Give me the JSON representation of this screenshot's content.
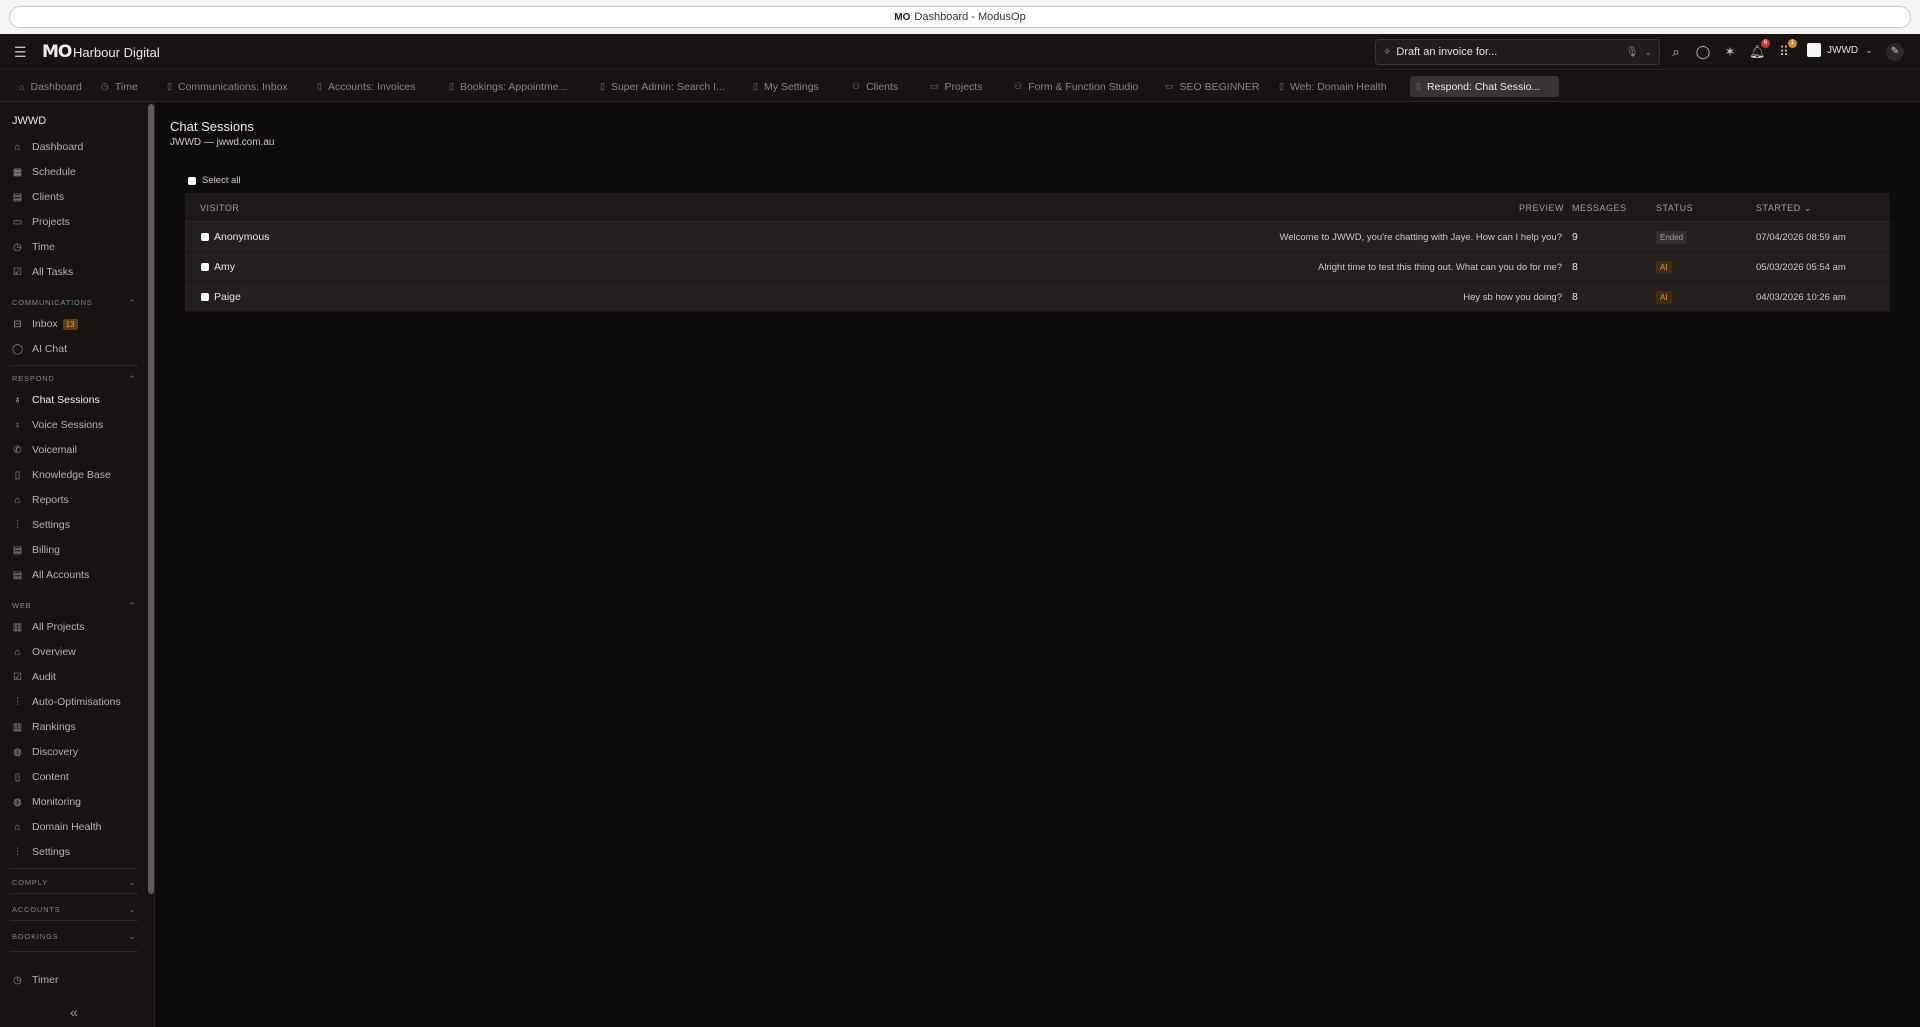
{
  "browser": {
    "title": "Dashboard - ModusOp",
    "favicon": "MO"
  },
  "header": {
    "logo": "MO",
    "org_name": "Harbour Digital",
    "ai_prompt_placeholder": "Draft an invoice for...",
    "notifications_badge": "6",
    "apps_badge": "1",
    "account_label": "JWWD"
  },
  "tabs": [
    {
      "label": "Dashboard",
      "icon": "home-icon"
    },
    {
      "label": "Time",
      "icon": "clock-icon"
    },
    {
      "label": "Communications: Inbox",
      "icon": "file-icon"
    },
    {
      "label": "Accounts: Invoices",
      "icon": "file-icon"
    },
    {
      "label": "Bookings: Appointme...",
      "icon": "file-icon"
    },
    {
      "label": "Super Admin: Search I...",
      "icon": "file-icon"
    },
    {
      "label": "My Settings",
      "icon": "file-icon"
    },
    {
      "label": "Clients",
      "icon": "users-icon"
    },
    {
      "label": "Projects",
      "icon": "folder-icon"
    },
    {
      "label": "Form & Function Studio",
      "icon": "users-icon"
    },
    {
      "label": "SEO BEGINNER",
      "icon": "folder-icon"
    },
    {
      "label": "Web: Domain Health",
      "icon": "file-icon"
    },
    {
      "label": "Respond: Chat Sessio...",
      "icon": "file-icon",
      "active": true
    }
  ],
  "sidebar": {
    "org": "JWWD",
    "main_items": [
      "Dashboard",
      "Schedule",
      "Clients",
      "Projects",
      "Time",
      "All Tasks"
    ],
    "communications": {
      "title": "COMMUNICATIONS",
      "items": [
        "Inbox",
        "AI Chat"
      ],
      "inbox_count": "13"
    },
    "respond": {
      "title": "RESPOND",
      "items": [
        "Chat Sessions",
        "Voice Sessions",
        "Voicemail",
        "Knowledge Base",
        "Reports",
        "Settings",
        "Billing",
        "All Accounts"
      ]
    },
    "web": {
      "title": "WEB",
      "items": [
        "All Projects",
        "Overview",
        "Audit",
        "Auto-Optimisations",
        "Rankings",
        "Discovery",
        "Content",
        "Monitoring",
        "Domain Health",
        "Settings"
      ]
    },
    "collapsed_sections": [
      "COMPLY",
      "ACCOUNTS",
      "BOOKINGS"
    ],
    "timer": "Timer"
  },
  "page": {
    "title": "Chat Sessions",
    "subtitle": "JWWD — jwwd.com.au",
    "select_all": "Select all",
    "columns": {
      "visitor": "VISITOR",
      "preview": "PREVIEW",
      "messages": "MESSAGES",
      "status": "STATUS",
      "started": "STARTED"
    },
    "rows": [
      {
        "visitor": "Anonymous",
        "preview": "Welcome to JWWD, you're chatting with Jaye. How can I help you?",
        "messages": "9",
        "status": "Ended",
        "started": "07/04/2026 08:59 am"
      },
      {
        "visitor": "Amy",
        "preview": "Alright time to test this thing out. What can you do for me?",
        "messages": "8",
        "status": "AI",
        "started": "05/03/2026 05:54 am"
      },
      {
        "visitor": "Paige",
        "preview": "Hey sb how you doing?",
        "messages": "8",
        "status": "AI",
        "started": "04/03/2026 10:26 am"
      }
    ]
  },
  "colors": {
    "background": "#0e0c0b",
    "panel": "#171310",
    "accent": "#d98a2b",
    "badge_red": "#c93a32"
  }
}
